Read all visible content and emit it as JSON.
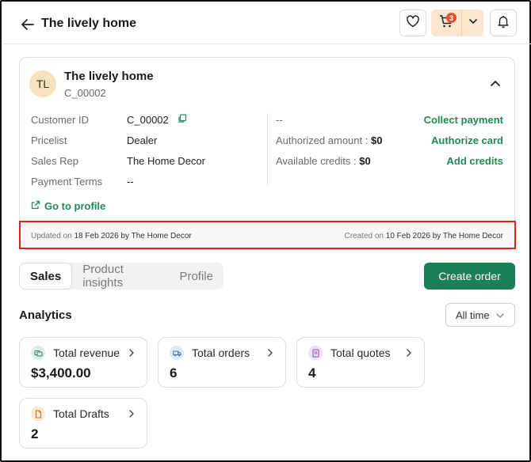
{
  "header": {
    "title": "The lively home",
    "cart_count": "3",
    "accent_color": "#1b7f57"
  },
  "customer": {
    "initials": "TL",
    "name": "The lively home",
    "code": "C_00002",
    "fields": [
      {
        "label": "Customer ID",
        "value": "C_00002"
      },
      {
        "label": "Pricelist",
        "value": "Dealer"
      },
      {
        "label": "Sales Rep",
        "value": "The Home Decor"
      },
      {
        "label": "Payment Terms",
        "value": "--"
      }
    ],
    "right": {
      "dash": "--",
      "authorized_label": "Authorized amount : ",
      "authorized_value": "$0",
      "credits_label": "Available credits : ",
      "credits_value": "$0",
      "collect_payment": "Collect payment",
      "authorize_card": "Authorize card",
      "add_credits": "Add credits"
    },
    "goto_profile": "Go to profile",
    "updated_prefix": "Updated on ",
    "updated_value": "18 Feb 2026 by The Home Decor",
    "created_prefix": "Created on ",
    "created_value": "10 Feb 2026 by The Home Decor"
  },
  "tabs": [
    {
      "label": "Sales",
      "active": true
    },
    {
      "label": "Product insights",
      "active": false
    },
    {
      "label": "Profile",
      "active": false
    }
  ],
  "create_order": "Create order",
  "analytics": {
    "title": "Analytics",
    "range": "All time",
    "stats": [
      {
        "label": "Total revenue",
        "value": "$3,400.00",
        "icon": "revenue-icon",
        "color": "#dcefe3"
      },
      {
        "label": "Total orders",
        "value": "6",
        "icon": "truck-icon",
        "color": "#e1e9f7"
      },
      {
        "label": "Total quotes",
        "value": "4",
        "icon": "quote-icon",
        "color": "#ece2f6"
      },
      {
        "label": "Total Drafts",
        "value": "2",
        "icon": "draft-icon",
        "color": "#fbe8cf"
      }
    ]
  }
}
